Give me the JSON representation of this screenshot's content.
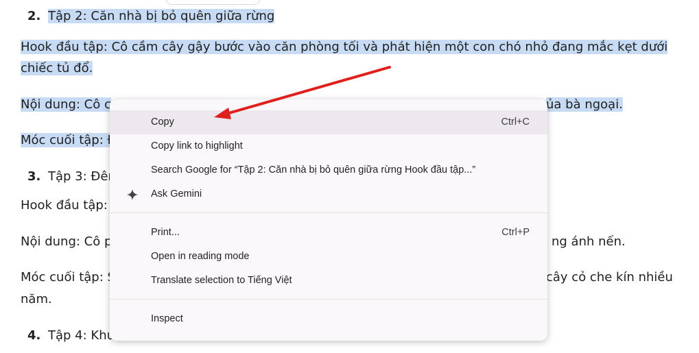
{
  "document": {
    "ep2_num": "2.",
    "ep2_title": "Tập 2: Căn nhà bị bỏ quên giữa rừng",
    "hook2_l1": "Hook đầu tập: Cô cầm cây gậy bước vào căn phòng tối và phát hiện một con chó nhỏ đang mắc kẹt dưới",
    "hook2_l2": "chiếc tủ đổ.",
    "content2_left": "Nội dung: Cô c",
    "content2_right": "ủa bà ngoại.",
    "cliff2_left": "Móc cuối tập: Đ",
    "ep3_num": "3.",
    "ep3_title": "Tập 3: Đêm",
    "hook3_left": "Hook đầu tập:",
    "content3_left": "Nội dung: Cô p",
    "content3_right": "ng ánh nến.",
    "cliff3_left": "Móc cuối tập: S",
    "cliff3_right": "cây cỏ che kín nhiều",
    "cliff3_l2": "năm.",
    "ep4_num": "4.",
    "ep4_title": "Tập 4: Khu"
  },
  "context_menu": {
    "copy": "Copy",
    "copy_shortcut": "Ctrl+C",
    "copy_link": "Copy link to highlight",
    "search_google": "Search Google for “Tập 2: Căn nhà bị bỏ quên giữa rừng  Hook đầu tập...”",
    "ask_gemini": "Ask Gemini",
    "print": "Print...",
    "print_shortcut": "Ctrl+P",
    "reading_mode": "Open in reading mode",
    "translate": "Translate selection to Tiếng Việt",
    "inspect": "Inspect"
  },
  "colors": {
    "selection": "#c7dbf5",
    "menu_bg": "#fbf8fc",
    "hover": "#ece8ee",
    "arrow": "#e0201c"
  },
  "icons": [
    "gemini-sparkle-icon",
    "red-annotation-arrow"
  ]
}
